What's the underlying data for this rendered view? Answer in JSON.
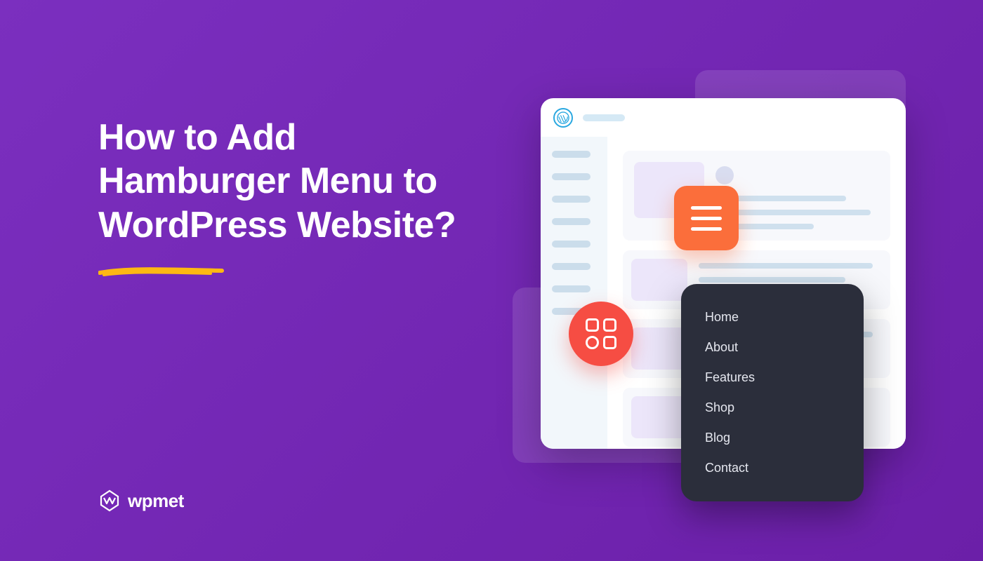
{
  "title": "How to Add Hamburger Menu to WordPress Website?",
  "brand": "wpmet",
  "menu_items": [
    "Home",
    "About",
    "Features",
    "Shop",
    "Blog",
    "Contact"
  ],
  "colors": {
    "background": "#7B2FBF",
    "hamburger": "#FB6E3B",
    "grid_icon": "#F64D43",
    "dropdown": "#2B2E3B",
    "underline": "#FDB813"
  }
}
